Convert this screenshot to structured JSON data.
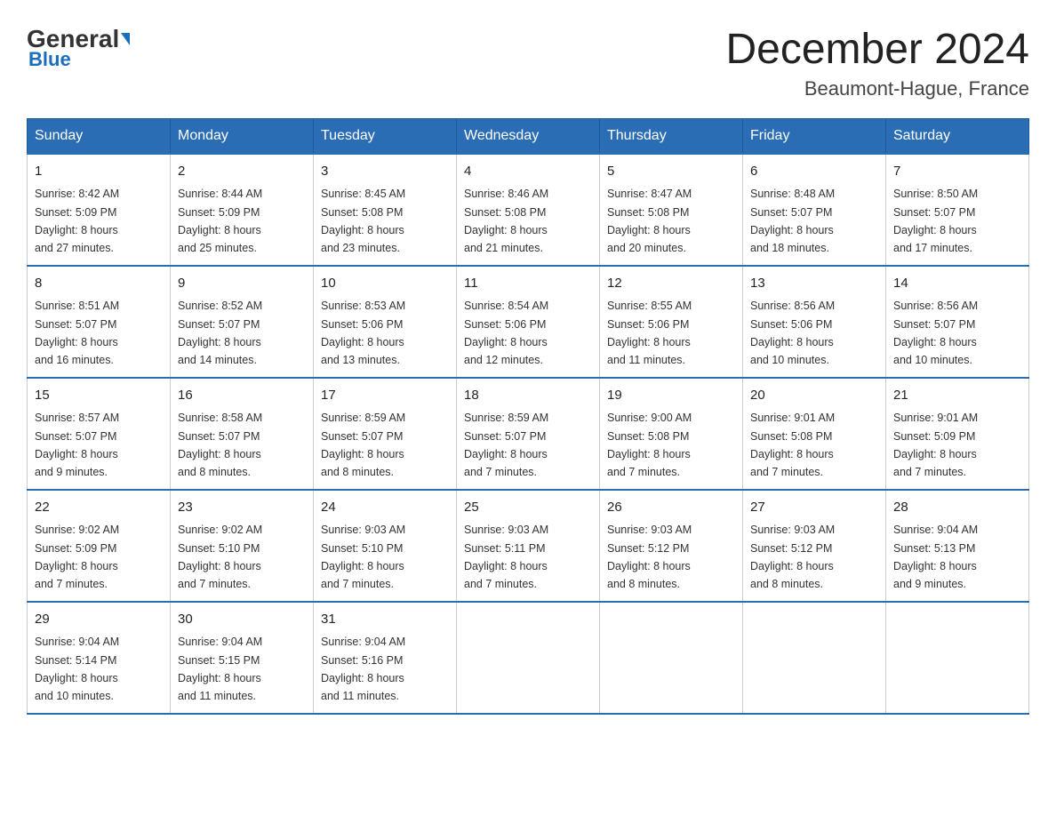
{
  "logo": {
    "general": "General",
    "blue": "Blue"
  },
  "title": {
    "month_year": "December 2024",
    "location": "Beaumont-Hague, France"
  },
  "weekdays": [
    "Sunday",
    "Monday",
    "Tuesday",
    "Wednesday",
    "Thursday",
    "Friday",
    "Saturday"
  ],
  "weeks": [
    [
      {
        "day": "1",
        "sunrise": "8:42 AM",
        "sunset": "5:09 PM",
        "daylight": "8 hours and 27 minutes."
      },
      {
        "day": "2",
        "sunrise": "8:44 AM",
        "sunset": "5:09 PM",
        "daylight": "8 hours and 25 minutes."
      },
      {
        "day": "3",
        "sunrise": "8:45 AM",
        "sunset": "5:08 PM",
        "daylight": "8 hours and 23 minutes."
      },
      {
        "day": "4",
        "sunrise": "8:46 AM",
        "sunset": "5:08 PM",
        "daylight": "8 hours and 21 minutes."
      },
      {
        "day": "5",
        "sunrise": "8:47 AM",
        "sunset": "5:08 PM",
        "daylight": "8 hours and 20 minutes."
      },
      {
        "day": "6",
        "sunrise": "8:48 AM",
        "sunset": "5:07 PM",
        "daylight": "8 hours and 18 minutes."
      },
      {
        "day": "7",
        "sunrise": "8:50 AM",
        "sunset": "5:07 PM",
        "daylight": "8 hours and 17 minutes."
      }
    ],
    [
      {
        "day": "8",
        "sunrise": "8:51 AM",
        "sunset": "5:07 PM",
        "daylight": "8 hours and 16 minutes."
      },
      {
        "day": "9",
        "sunrise": "8:52 AM",
        "sunset": "5:07 PM",
        "daylight": "8 hours and 14 minutes."
      },
      {
        "day": "10",
        "sunrise": "8:53 AM",
        "sunset": "5:06 PM",
        "daylight": "8 hours and 13 minutes."
      },
      {
        "day": "11",
        "sunrise": "8:54 AM",
        "sunset": "5:06 PM",
        "daylight": "8 hours and 12 minutes."
      },
      {
        "day": "12",
        "sunrise": "8:55 AM",
        "sunset": "5:06 PM",
        "daylight": "8 hours and 11 minutes."
      },
      {
        "day": "13",
        "sunrise": "8:56 AM",
        "sunset": "5:06 PM",
        "daylight": "8 hours and 10 minutes."
      },
      {
        "day": "14",
        "sunrise": "8:56 AM",
        "sunset": "5:07 PM",
        "daylight": "8 hours and 10 minutes."
      }
    ],
    [
      {
        "day": "15",
        "sunrise": "8:57 AM",
        "sunset": "5:07 PM",
        "daylight": "8 hours and 9 minutes."
      },
      {
        "day": "16",
        "sunrise": "8:58 AM",
        "sunset": "5:07 PM",
        "daylight": "8 hours and 8 minutes."
      },
      {
        "day": "17",
        "sunrise": "8:59 AM",
        "sunset": "5:07 PM",
        "daylight": "8 hours and 8 minutes."
      },
      {
        "day": "18",
        "sunrise": "8:59 AM",
        "sunset": "5:07 PM",
        "daylight": "8 hours and 7 minutes."
      },
      {
        "day": "19",
        "sunrise": "9:00 AM",
        "sunset": "5:08 PM",
        "daylight": "8 hours and 7 minutes."
      },
      {
        "day": "20",
        "sunrise": "9:01 AM",
        "sunset": "5:08 PM",
        "daylight": "8 hours and 7 minutes."
      },
      {
        "day": "21",
        "sunrise": "9:01 AM",
        "sunset": "5:09 PM",
        "daylight": "8 hours and 7 minutes."
      }
    ],
    [
      {
        "day": "22",
        "sunrise": "9:02 AM",
        "sunset": "5:09 PM",
        "daylight": "8 hours and 7 minutes."
      },
      {
        "day": "23",
        "sunrise": "9:02 AM",
        "sunset": "5:10 PM",
        "daylight": "8 hours and 7 minutes."
      },
      {
        "day": "24",
        "sunrise": "9:03 AM",
        "sunset": "5:10 PM",
        "daylight": "8 hours and 7 minutes."
      },
      {
        "day": "25",
        "sunrise": "9:03 AM",
        "sunset": "5:11 PM",
        "daylight": "8 hours and 7 minutes."
      },
      {
        "day": "26",
        "sunrise": "9:03 AM",
        "sunset": "5:12 PM",
        "daylight": "8 hours and 8 minutes."
      },
      {
        "day": "27",
        "sunrise": "9:03 AM",
        "sunset": "5:12 PM",
        "daylight": "8 hours and 8 minutes."
      },
      {
        "day": "28",
        "sunrise": "9:04 AM",
        "sunset": "5:13 PM",
        "daylight": "8 hours and 9 minutes."
      }
    ],
    [
      {
        "day": "29",
        "sunrise": "9:04 AM",
        "sunset": "5:14 PM",
        "daylight": "8 hours and 10 minutes."
      },
      {
        "day": "30",
        "sunrise": "9:04 AM",
        "sunset": "5:15 PM",
        "daylight": "8 hours and 11 minutes."
      },
      {
        "day": "31",
        "sunrise": "9:04 AM",
        "sunset": "5:16 PM",
        "daylight": "8 hours and 11 minutes."
      },
      null,
      null,
      null,
      null
    ]
  ],
  "labels": {
    "sunrise": "Sunrise:",
    "sunset": "Sunset:",
    "daylight": "Daylight:"
  }
}
